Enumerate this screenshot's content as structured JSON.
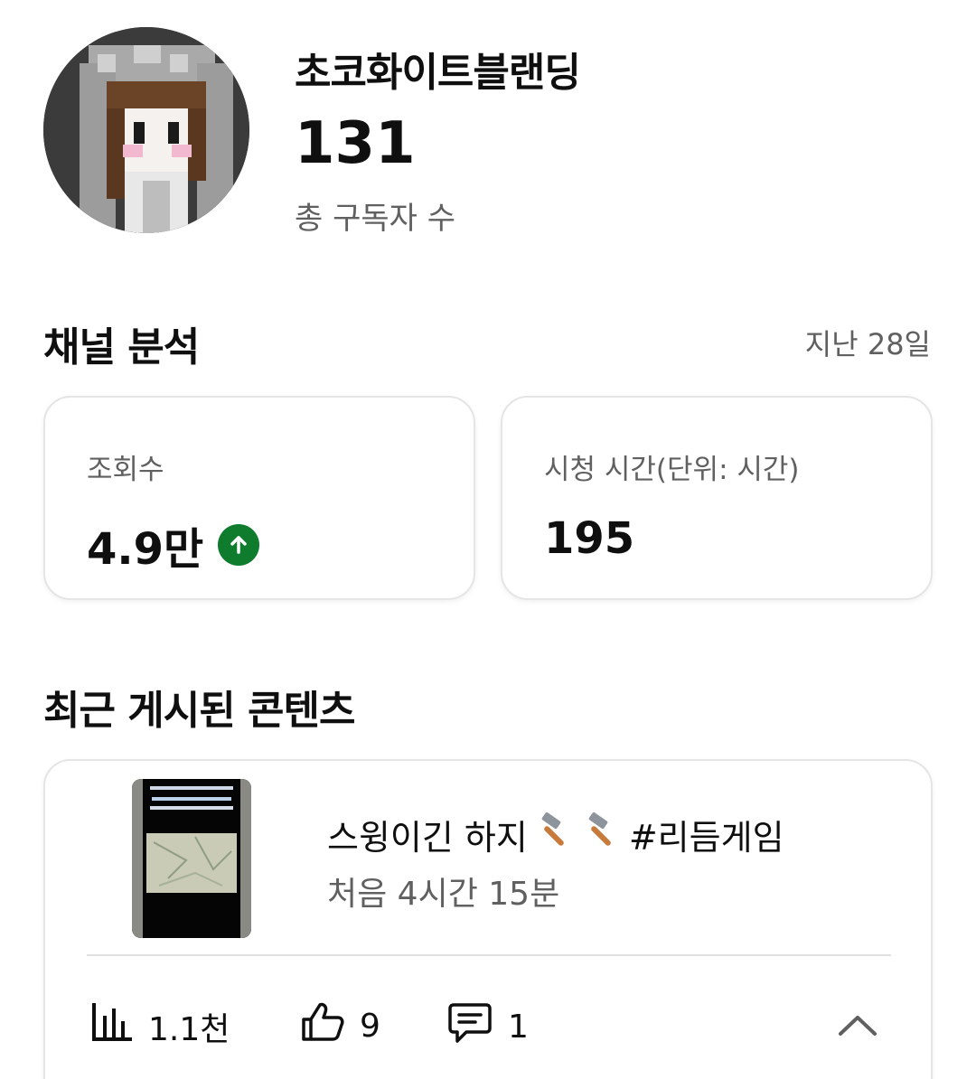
{
  "channel": {
    "name": "초코화이트블랜딩",
    "subscriber_count": "131",
    "subscriber_label": "총 구독자 수"
  },
  "analytics": {
    "title": "채널 분석",
    "period": "지난 28일",
    "views": {
      "label": "조회수",
      "value": "4.9만",
      "trend_icon": "arrow-up-circle-icon",
      "trend_color": "#0f7b2c"
    },
    "watch_time": {
      "label": "시청 시간(단위: 시간)",
      "value": "195"
    }
  },
  "recent": {
    "title": "최근 게시된 콘텐츠",
    "video": {
      "title": "스윙이긴 하지",
      "hashtag": "#리듬게임",
      "emoji_icons": [
        "hammer-icon",
        "hammer-icon"
      ],
      "subtitle": "처음 4시간 15분",
      "views": "1.1천",
      "likes": "9",
      "comments": "1"
    }
  }
}
